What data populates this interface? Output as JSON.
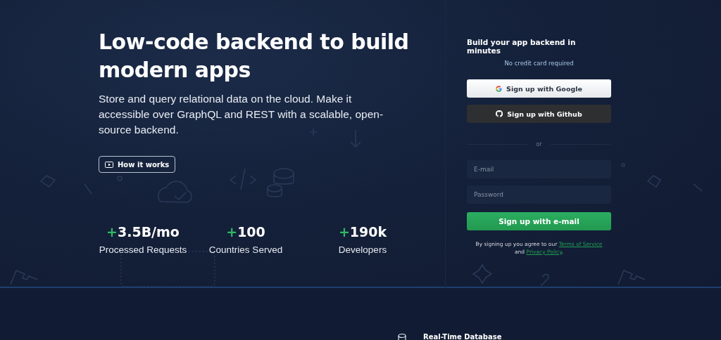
{
  "hero": {
    "title": "Low-code backend to build modern apps",
    "subtitle": "Store and query relational data on the cloud. Make it accessible over GraphQL and REST with a scalable, open-source backend.",
    "video_button": "How it works",
    "stats": [
      {
        "value": "3.5B/mo",
        "prefix": "+",
        "label": "Processed Requests"
      },
      {
        "value": "100",
        "prefix": "+",
        "label": "Countries Served"
      },
      {
        "value": "190k",
        "prefix": "+",
        "label": "Developers"
      }
    ]
  },
  "signup": {
    "title": "Build your app backend in minutes",
    "subtitle": "No credit card required",
    "providers": [
      {
        "kind": "google",
        "label": "Sign up with Google"
      },
      {
        "kind": "github",
        "label": "Sign up with Github"
      }
    ],
    "divider": "or",
    "email": {
      "placeholder": "E-mail"
    },
    "password": {
      "placeholder": "Password"
    },
    "submit": "Sign up with e-mail",
    "legal": {
      "text": "By signing up you agree to our",
      "terms": "Terms of Service",
      "and": "and",
      "privacy": "Privacy Policy",
      "end": "."
    }
  },
  "features": [
    {
      "title": "Real-Time Database"
    }
  ]
}
